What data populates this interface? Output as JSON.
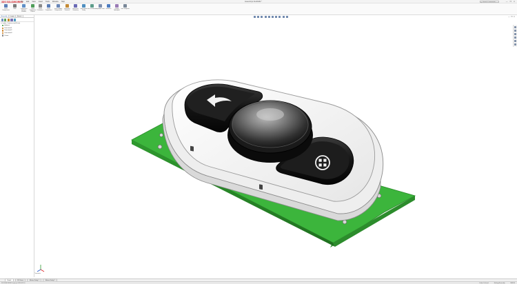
{
  "app": {
    "logo": "3DS SOLIDWORKS",
    "document_title": "Assembly1.SLDASM *",
    "menu": [
      "File",
      "Edit",
      "View",
      "Insert",
      "Tools",
      "Window",
      "Help"
    ],
    "search_placeholder": "Search Commands",
    "window_controls": [
      "—",
      "❐",
      "✕"
    ]
  },
  "command_manager": [
    {
      "label": "Insert Components",
      "color": "#5b7fb8"
    },
    {
      "label": "Mate",
      "color": "#7a7a7a"
    },
    {
      "label": "Component Preview Window",
      "color": "#5e8fc7"
    },
    {
      "label": "Linear Component Pattern",
      "color": "#4f9d59"
    },
    {
      "label": "Smart Fasteners",
      "color": "#8a8a8a"
    },
    {
      "label": "Move Component",
      "color": "#5a7db5"
    },
    {
      "label": "Show Hidden Components",
      "color": "#6b88b8"
    },
    {
      "label": "Assembly Features",
      "color": "#c48a35"
    },
    {
      "label": "Reference Geometry",
      "color": "#6b6bb5"
    },
    {
      "label": "New Motion Study",
      "color": "#4f8fc0"
    },
    {
      "label": "Bill of Materials",
      "color": "#5d9c8a"
    },
    {
      "label": "Exploded View",
      "color": "#7c8fb0"
    },
    {
      "label": "Instant3D",
      "color": "#4d7cc0"
    },
    {
      "label": "Update Speedpak",
      "color": "#9a7bb5"
    },
    {
      "label": "Take Snapshot",
      "color": "#7a8898"
    }
  ],
  "panel": {
    "tabs": [
      "Assembly",
      "Layout",
      "Sketch"
    ],
    "tree_root": "Lights, Cameras and Scene",
    "tree_items": [
      {
        "label": "Ambient",
        "kind": "green"
      },
      {
        "label": "Directional1",
        "kind": "orange"
      },
      {
        "label": "Directional2",
        "kind": "orange"
      },
      {
        "label": "Directional3",
        "kind": "orange"
      },
      {
        "label": "Scene",
        "kind": "grey"
      }
    ]
  },
  "bottom_tabs": [
    "Model",
    "3D Views",
    "Motion Study 1",
    "Motion Study 2"
  ],
  "status": {
    "left": "SOLIDWORKS Premium 2024 SP1.0",
    "right": [
      "Under Defined",
      "Editing Assembly",
      "MMGS"
    ]
  },
  "view_label": "*Isometric",
  "colors": {
    "pcb": "#3cb53c",
    "housing": "#f4f4f4",
    "button": "#1c1c1c",
    "accent": "#d71920"
  },
  "icons": {
    "back_button": "arrow-back-icon",
    "menu_button": "grid-dots-icon"
  }
}
